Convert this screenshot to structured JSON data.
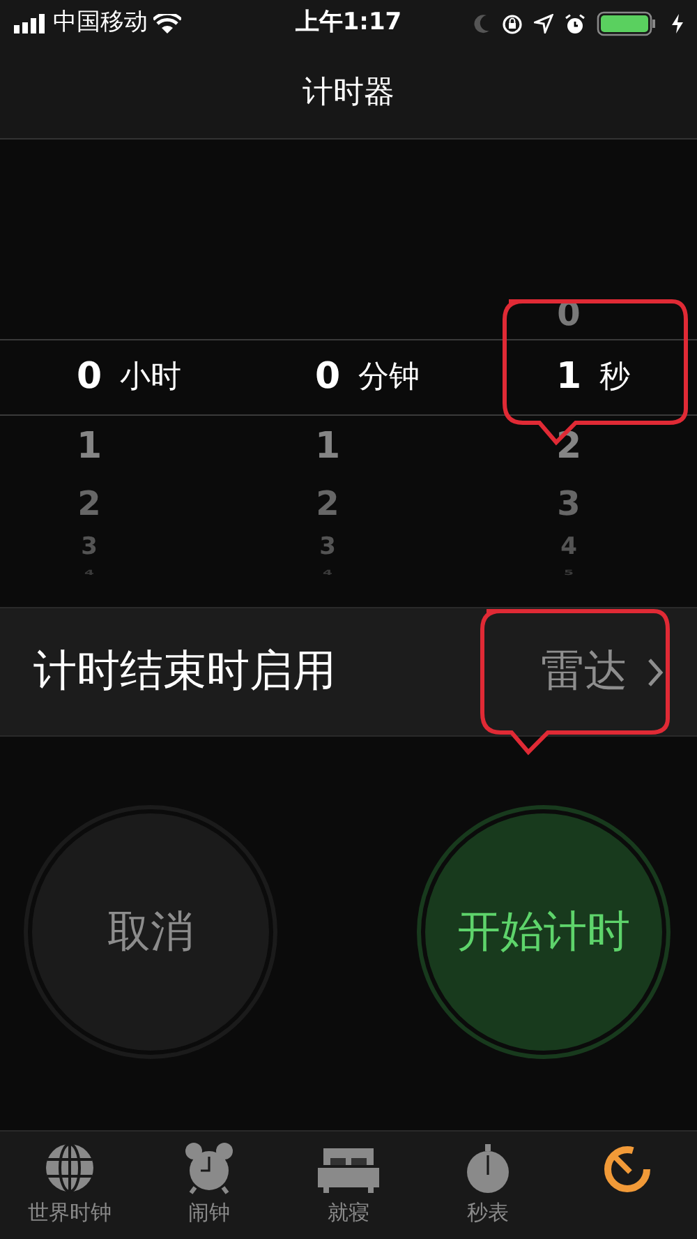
{
  "status_bar": {
    "carrier": "中国移动",
    "time": "上午1:17"
  },
  "title": "计时器",
  "picker": [
    {
      "value": "0",
      "unit": "小时",
      "below": [
        "1",
        "2",
        "3",
        "4"
      ]
    },
    {
      "value": "0",
      "unit": "分钟",
      "below": [
        "1",
        "2",
        "3",
        "4"
      ]
    },
    {
      "above": [
        "0"
      ],
      "value": "1",
      "unit": "秒",
      "below": [
        "2",
        "3",
        "4",
        "5"
      ]
    }
  ],
  "when_ends": {
    "label": "计时结束时启用",
    "value": "雷达"
  },
  "buttons": [
    {
      "kind": "cancel",
      "label": "取消"
    },
    {
      "kind": "start",
      "label": "开始计时"
    }
  ],
  "tabs": [
    {
      "kind": "globe",
      "label": "世界时钟",
      "selected": false
    },
    {
      "kind": "alarm",
      "label": "闹钟",
      "selected": false
    },
    {
      "kind": "bed",
      "label": "就寝",
      "selected": false
    },
    {
      "kind": "stopwatch",
      "label": "秒表",
      "selected": false
    },
    {
      "kind": "timer",
      "selected": true
    }
  ]
}
